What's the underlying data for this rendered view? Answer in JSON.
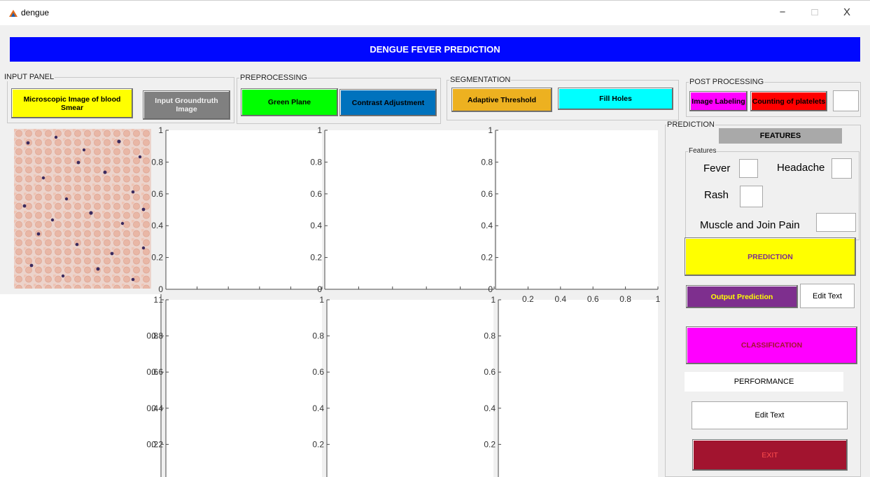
{
  "window": {
    "title": "dengue",
    "minimize_label": "−",
    "maximize_label": "□",
    "close_label": "X"
  },
  "header": {
    "title": "DENGUE FEVER PREDICTION"
  },
  "input_panel": {
    "title": "INPUT PANEL",
    "microscopic_button": "Microscopic Image of blood Smear",
    "groundtruth_button": "Input Groundtruth Image"
  },
  "preprocessing": {
    "title": "PREPROCESSING",
    "green_plane_button": "Green Plane",
    "contrast_button": "Contrast Adjustment"
  },
  "segmentation": {
    "title": "SEGMENTATION",
    "adaptive_threshold_button": "Adaptive Threshold",
    "fill_holes_button": "Fill Holes"
  },
  "post_processing": {
    "title": "POST PROCESSING",
    "image_labeling_button": "Image Labeling",
    "counting_button": "Counting of platelets",
    "count_value": ""
  },
  "prediction_panel": {
    "title": "PREDICTION",
    "features_header": "FEATURES",
    "features_group_title": "Features",
    "fever_label": "Fever",
    "fever_value": "",
    "headache_label": "Headache",
    "headache_value": "",
    "rash_label": "Rash",
    "rash_value": "",
    "muscle_label": "Muscle and Join Pain",
    "muscle_value": "",
    "prediction_button": "PREDICTION",
    "output_prediction_button": "Output Prediction",
    "output_edit_text": "Edit Text",
    "classification_button": "CLASSIFICATION",
    "performance_label": "PERFORMANCE",
    "performance_edit_text": "Edit Text",
    "exit_button": "EXIT"
  },
  "axes": {
    "y_ticks": [
      "0",
      "0.2",
      "0.4",
      "0.6",
      "0.8",
      "1"
    ],
    "x_ticks": [
      "0.2",
      "0.4",
      "0.6",
      "0.8",
      "1"
    ]
  },
  "colors": {
    "header_blue": "#0008ff",
    "yellow": "#ffff00",
    "gray_button": "#808080",
    "green": "#00ff00",
    "contrast_blue": "#0072bd",
    "orange": "#edb120",
    "cyan": "#00ffff",
    "magenta": "#ff00ff",
    "red": "#ff0000",
    "purple": "#7e2f8e",
    "exit_red": "#a2142f"
  }
}
